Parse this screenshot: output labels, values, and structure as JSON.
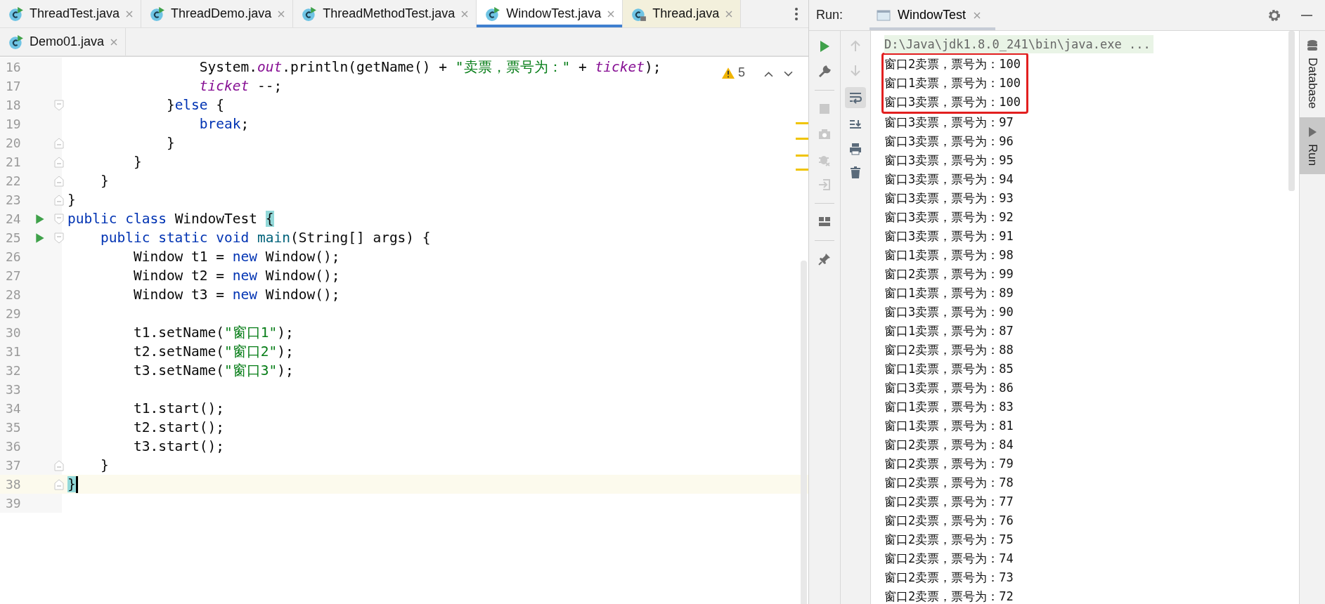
{
  "editor": {
    "tab_rows": [
      [
        {
          "label": "ThreadTest.java",
          "kind": "source",
          "selected": false
        },
        {
          "label": "ThreadDemo.java",
          "kind": "source",
          "selected": false
        },
        {
          "label": "ThreadMethodTest.java",
          "kind": "source",
          "selected": false
        },
        {
          "label": "WindowTest.java",
          "kind": "source",
          "selected": true
        },
        {
          "label": "Thread.java",
          "kind": "library",
          "selected": false
        }
      ],
      [
        {
          "label": "Demo01.java",
          "kind": "source",
          "selected": false
        }
      ]
    ],
    "warnings": {
      "count": "5"
    },
    "lines": [
      {
        "number": "16",
        "current": false,
        "run_marker": false,
        "tokens": [
          {
            "text": "                System.",
            "kind": "plain"
          },
          {
            "text": "out",
            "kind": "field"
          },
          {
            "text": ".println(getName() + ",
            "kind": "plain"
          },
          {
            "text": "\"卖票，票号为：\"",
            "kind": "string"
          },
          {
            "text": " + ",
            "kind": "plain"
          },
          {
            "text": "ticket",
            "kind": "field"
          },
          {
            "text": ");",
            "kind": "plain"
          }
        ]
      },
      {
        "number": "17",
        "current": false,
        "run_marker": false,
        "tokens": [
          {
            "text": "                ticket",
            "kind": "field"
          },
          {
            "text": " --;",
            "kind": "plain"
          }
        ]
      },
      {
        "number": "18",
        "current": false,
        "run_marker": false,
        "fold_marker": true,
        "fold_end": false,
        "tokens": [
          {
            "text": "            }",
            "kind": "plain"
          },
          {
            "text": "else",
            "kind": "keyword"
          },
          {
            "text": " {",
            "kind": "plain"
          }
        ]
      },
      {
        "number": "19",
        "current": false,
        "run_marker": false,
        "tokens": [
          {
            "text": "                break",
            "kind": "keyword"
          },
          {
            "text": ";",
            "kind": "plain"
          }
        ]
      },
      {
        "number": "20",
        "current": false,
        "run_marker": false,
        "fold_marker": true,
        "fold_end": true,
        "tokens": [
          {
            "text": "            }",
            "kind": "plain"
          }
        ]
      },
      {
        "number": "21",
        "current": false,
        "run_marker": false,
        "fold_marker": true,
        "fold_end": true,
        "tokens": [
          {
            "text": "        }",
            "kind": "plain"
          }
        ]
      },
      {
        "number": "22",
        "current": false,
        "run_marker": false,
        "fold_marker": true,
        "fold_end": true,
        "tokens": [
          {
            "text": "    }",
            "kind": "plain"
          }
        ]
      },
      {
        "number": "23",
        "current": false,
        "run_marker": false,
        "fold_marker": true,
        "fold_end": true,
        "tokens": [
          {
            "text": "}",
            "kind": "plain"
          }
        ]
      },
      {
        "number": "24",
        "current": false,
        "run_marker": true,
        "fold_marker": true,
        "fold_end": false,
        "tokens": [
          {
            "text": "public class",
            "kind": "keyword"
          },
          {
            "text": " WindowTest ",
            "kind": "plain"
          },
          {
            "text": "{",
            "kind": "brace_match"
          }
        ]
      },
      {
        "number": "25",
        "current": false,
        "run_marker": true,
        "fold_marker": true,
        "fold_end": false,
        "tokens": [
          {
            "text": "    public static void ",
            "kind": "keyword"
          },
          {
            "text": "main",
            "kind": "method"
          },
          {
            "text": "(String[] args) {",
            "kind": "plain"
          }
        ]
      },
      {
        "number": "26",
        "current": false,
        "run_marker": false,
        "tokens": [
          {
            "text": "        Window t1 = ",
            "kind": "plain"
          },
          {
            "text": "new",
            "kind": "keyword"
          },
          {
            "text": " Window();",
            "kind": "plain"
          }
        ]
      },
      {
        "number": "27",
        "current": false,
        "run_marker": false,
        "tokens": [
          {
            "text": "        Window t2 = ",
            "kind": "plain"
          },
          {
            "text": "new",
            "kind": "keyword"
          },
          {
            "text": " Window();",
            "kind": "plain"
          }
        ]
      },
      {
        "number": "28",
        "current": false,
        "run_marker": false,
        "tokens": [
          {
            "text": "        Window t3 = ",
            "kind": "plain"
          },
          {
            "text": "new",
            "kind": "keyword"
          },
          {
            "text": " Window();",
            "kind": "plain"
          }
        ]
      },
      {
        "number": "29",
        "current": false,
        "run_marker": false
      },
      {
        "number": "30",
        "current": false,
        "run_marker": false,
        "tokens": [
          {
            "text": "        t1.setName(",
            "kind": "plain"
          },
          {
            "text": "\"窗口1\"",
            "kind": "string"
          },
          {
            "text": ");",
            "kind": "plain"
          }
        ]
      },
      {
        "number": "31",
        "current": false,
        "run_marker": false,
        "tokens": [
          {
            "text": "        t2.setName(",
            "kind": "plain"
          },
          {
            "text": "\"窗口2\"",
            "kind": "string"
          },
          {
            "text": ");",
            "kind": "plain"
          }
        ]
      },
      {
        "number": "32",
        "current": false,
        "run_marker": false,
        "tokens": [
          {
            "text": "        t3.setName(",
            "kind": "plain"
          },
          {
            "text": "\"窗口3\"",
            "kind": "string"
          },
          {
            "text": ");",
            "kind": "plain"
          }
        ]
      },
      {
        "number": "33",
        "current": false,
        "run_marker": false
      },
      {
        "number": "34",
        "current": false,
        "run_marker": false,
        "tokens": [
          {
            "text": "        t1.start();",
            "kind": "plain"
          }
        ]
      },
      {
        "number": "35",
        "current": false,
        "run_marker": false,
        "tokens": [
          {
            "text": "        t2.start();",
            "kind": "plain"
          }
        ]
      },
      {
        "number": "36",
        "current": false,
        "run_marker": false,
        "tokens": [
          {
            "text": "        t3.start();",
            "kind": "plain"
          }
        ]
      },
      {
        "number": "37",
        "current": false,
        "run_marker": false,
        "fold_marker": true,
        "fold_end": true,
        "tokens": [
          {
            "text": "    }",
            "kind": "plain"
          }
        ]
      },
      {
        "number": "38",
        "current": true,
        "run_marker": false,
        "fold_marker": true,
        "fold_end": true,
        "tokens": [
          {
            "text": "}",
            "kind": "brace_match"
          }
        ]
      },
      {
        "number": "39",
        "current": false,
        "run_marker": false
      }
    ]
  },
  "run_panel": {
    "label": "Run:",
    "tab": {
      "title": "WindowTest"
    },
    "command": "D:\\Java\\jdk1.8.0_241\\bin\\java.exe ...",
    "output": [
      {
        "text": "窗口2卖票，票号为：100",
        "highlighted": true
      },
      {
        "text": "窗口1卖票，票号为：100",
        "highlighted": true
      },
      {
        "text": "窗口3卖票，票号为：100",
        "highlighted": true
      },
      {
        "text": "窗口3卖票，票号为：97",
        "highlighted": false
      },
      {
        "text": "窗口3卖票，票号为：96",
        "highlighted": false
      },
      {
        "text": "窗口3卖票，票号为：95",
        "highlighted": false
      },
      {
        "text": "窗口3卖票，票号为：94",
        "highlighted": false
      },
      {
        "text": "窗口3卖票，票号为：93",
        "highlighted": false
      },
      {
        "text": "窗口3卖票，票号为：92",
        "highlighted": false
      },
      {
        "text": "窗口3卖票，票号为：91",
        "highlighted": false
      },
      {
        "text": "窗口1卖票，票号为：98",
        "highlighted": false
      },
      {
        "text": "窗口2卖票，票号为：99",
        "highlighted": false
      },
      {
        "text": "窗口1卖票，票号为：89",
        "highlighted": false
      },
      {
        "text": "窗口3卖票，票号为：90",
        "highlighted": false
      },
      {
        "text": "窗口1卖票，票号为：87",
        "highlighted": false
      },
      {
        "text": "窗口2卖票，票号为：88",
        "highlighted": false
      },
      {
        "text": "窗口1卖票，票号为：85",
        "highlighted": false
      },
      {
        "text": "窗口3卖票，票号为：86",
        "highlighted": false
      },
      {
        "text": "窗口1卖票，票号为：83",
        "highlighted": false
      },
      {
        "text": "窗口1卖票，票号为：81",
        "highlighted": false
      },
      {
        "text": "窗口2卖票，票号为：84",
        "highlighted": false
      },
      {
        "text": "窗口2卖票，票号为：79",
        "highlighted": false
      },
      {
        "text": "窗口2卖票，票号为：78",
        "highlighted": false
      },
      {
        "text": "窗口2卖票，票号为：77",
        "highlighted": false
      },
      {
        "text": "窗口2卖票，票号为：76",
        "highlighted": false
      },
      {
        "text": "窗口2卖票，票号为：75",
        "highlighted": false
      },
      {
        "text": "窗口2卖票，票号为：74",
        "highlighted": false
      },
      {
        "text": "窗口2卖票，票号为：73",
        "highlighted": false
      },
      {
        "text": "窗口2卖票，票号为：72",
        "highlighted": false
      }
    ]
  },
  "side_tabs": [
    {
      "label": "Database",
      "selected": false
    },
    {
      "label": "Run",
      "selected": true
    }
  ]
}
